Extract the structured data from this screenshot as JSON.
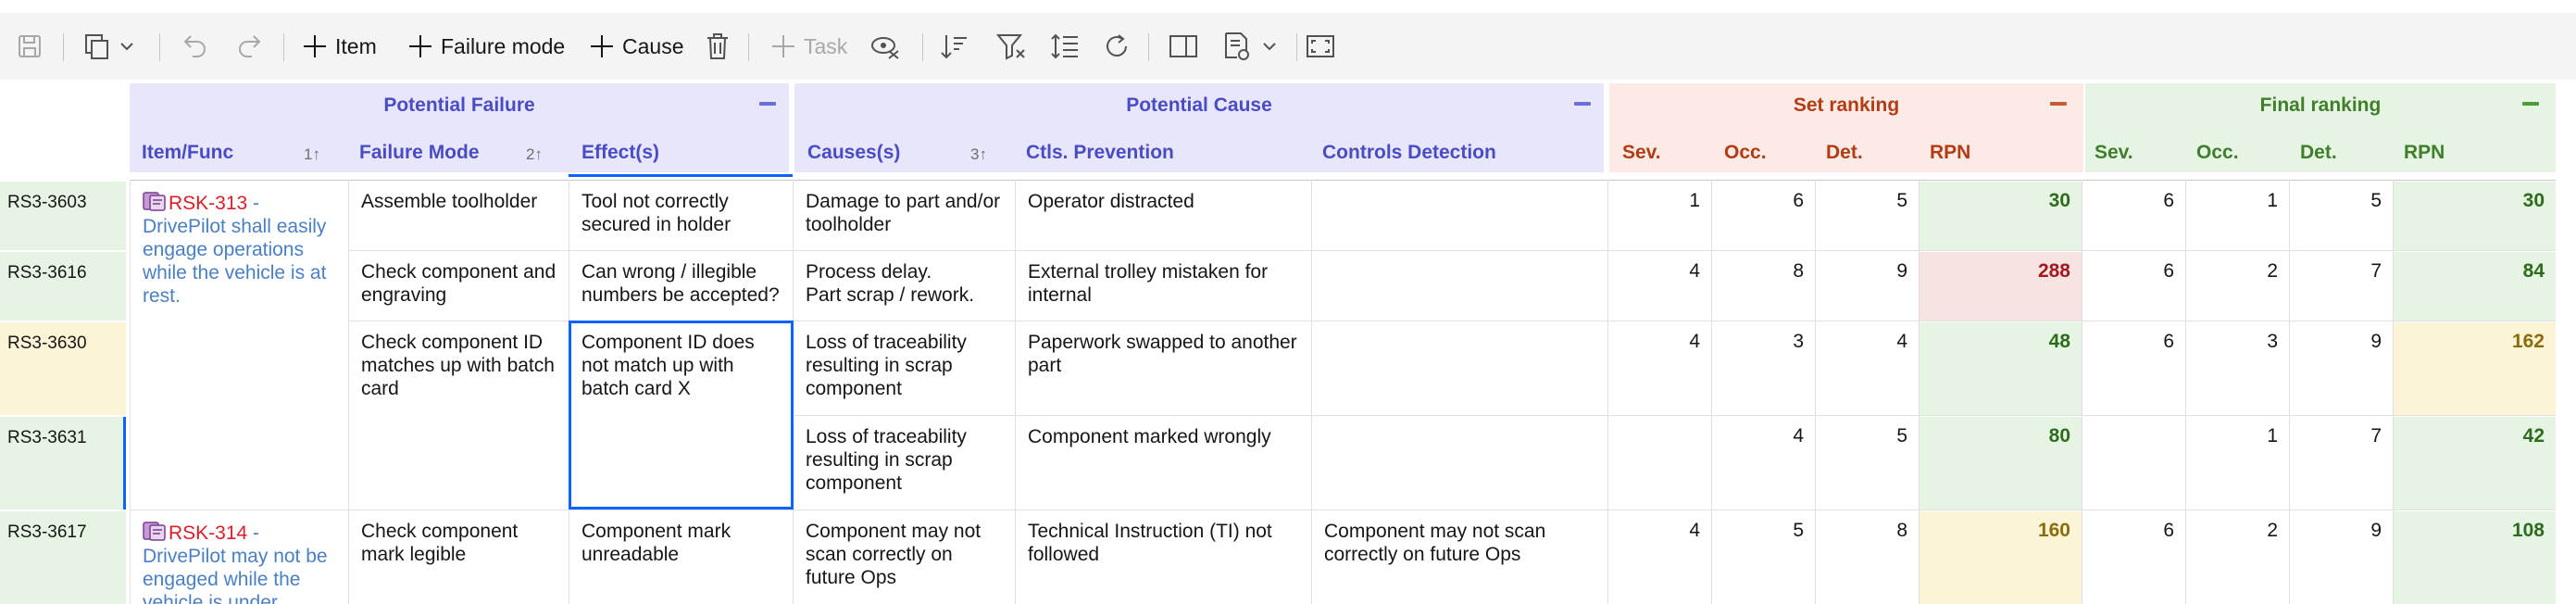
{
  "toolbar": {
    "add_item": "Item",
    "add_failure_mode": "Failure mode",
    "add_cause": "Cause",
    "add_task": "Task"
  },
  "groups": {
    "potential_failure": "Potential Failure",
    "potential_cause": "Potential Cause",
    "set_ranking": "Set ranking",
    "final_ranking": "Final ranking"
  },
  "columns": {
    "item_func": "Item/Func",
    "item_func_sort": "1",
    "failure_mode": "Failure Mode",
    "failure_mode_sort": "2",
    "effects": "Effect(s)",
    "causes": "Causes(s)",
    "causes_sort": "3",
    "ctls_prevention": "Ctls. Prevention",
    "controls_detection": "Controls Detection",
    "set_sev": "Sev.",
    "set_occ": "Occ.",
    "set_det": "Det.",
    "set_rpn": "RPN",
    "final_sev": "Sev.",
    "final_occ": "Occ.",
    "final_det": "Det.",
    "final_rpn": "RPN"
  },
  "items": [
    {
      "id": "RSK-313",
      "sep": " - ",
      "text": "DrivePilot shall easily engage operations while the vehicle is at rest."
    },
    {
      "id": "RSK-314",
      "sep": " - ",
      "text": "DrivePilot may not be engaged while the vehicle is under"
    }
  ],
  "rows": [
    {
      "row_id": "RS3-3603",
      "failure_mode": "Assemble toolholder",
      "effect": "Tool not correctly secured in holder",
      "cause": "Damage to part and/or toolholder",
      "prevention": "Operator distracted",
      "detection": "",
      "set": {
        "sev": "1",
        "occ": "6",
        "det": "5",
        "rpn": "30"
      },
      "final": {
        "sev": "6",
        "occ": "1",
        "det": "5",
        "rpn": "30"
      }
    },
    {
      "row_id": "RS3-3616",
      "failure_mode": "Check component and engraving",
      "effect": "Can wrong  / illegible numbers be accepted?",
      "cause": "Process delay.\nPart scrap / rework.",
      "prevention": "External trolley mistaken for internal",
      "detection": "",
      "set": {
        "sev": "4",
        "occ": "8",
        "det": "9",
        "rpn": "288"
      },
      "final": {
        "sev": "6",
        "occ": "2",
        "det": "7",
        "rpn": "84"
      }
    },
    {
      "row_id": "RS3-3630",
      "failure_mode": "Check component ID matches up with batch card",
      "effect": "Component ID does not match up with batch card X",
      "cause": "Loss of traceability resulting in scrap component",
      "prevention": "Paperwork swapped to another part",
      "detection": "",
      "set": {
        "sev": "4",
        "occ": "3",
        "det": "4",
        "rpn": "48"
      },
      "final": {
        "sev": "6",
        "occ": "3",
        "det": "9",
        "rpn": "162"
      }
    },
    {
      "row_id": "RS3-3631",
      "failure_mode": "",
      "effect": "",
      "cause": "Loss of traceability resulting in scrap component",
      "prevention": "Component marked wrongly",
      "detection": "",
      "set": {
        "sev": "",
        "occ": "4",
        "det": "5",
        "rpn": "80"
      },
      "final": {
        "sev": "",
        "occ": "1",
        "det": "7",
        "rpn": "42"
      }
    },
    {
      "row_id": "RS3-3617",
      "failure_mode": "Check component mark legible",
      "effect": "Component mark unreadable",
      "cause": "Component may not scan correctly on future Ops",
      "prevention": "Technical Instruction (TI) not followed",
      "detection": "Component may not scan correctly on future Ops",
      "set": {
        "sev": "4",
        "occ": "5",
        "det": "8",
        "rpn": "160"
      },
      "final": {
        "sev": "6",
        "occ": "2",
        "det": "9",
        "rpn": "108"
      }
    }
  ],
  "colors": {
    "potential_failure_header": "#e8e6fb",
    "potential_cause_header": "#e8e6fb",
    "set_ranking_header": "#fbeae5",
    "final_ranking_header": "#e6f4e3",
    "rpn_low_bg": "#e6f4e3",
    "rpn_mid_bg": "#fcf4d6",
    "rpn_high_bg": "#f6e4e2",
    "rpn_low_text": "#2f6b1e",
    "rpn_mid_text": "#8a6d0a",
    "rpn_high_text": "#a2191f",
    "row_id_green_bg": "#e6f4e3",
    "row_id_yellow_bg": "#fcf4d6",
    "focus_border": "#0f62fe"
  }
}
